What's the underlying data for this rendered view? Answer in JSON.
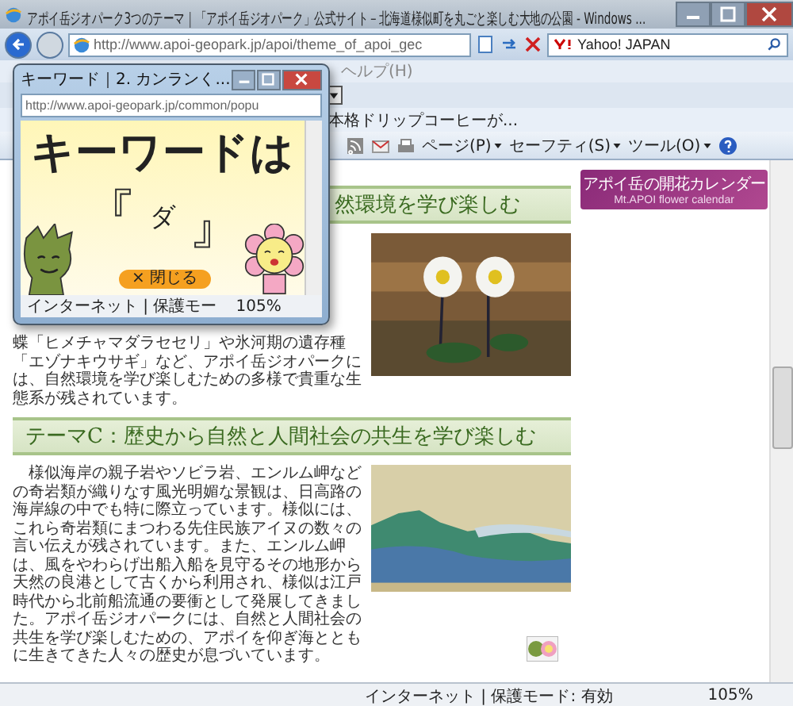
{
  "window": {
    "title": "アポイ岳ジオパーク3つのテーマ｜「アポイ岳ジオパーク」公式サイト－北海道様似町を丸ごと楽しむ大地の公園 - Windows ..."
  },
  "address_bar": {
    "url": "http://www.apoi-geopark.jp/apoi/theme_of_apoi_gec",
    "search_value": "Yahoo! JAPAN"
  },
  "menu": [
    "ヘルプ(H)"
  ],
  "favorites_link": "本格ドリップコーヒーが...",
  "command_bar": [
    "ページ(P)",
    "セーフティ(S)",
    "ツール(O)"
  ],
  "page": {
    "theme_b": {
      "heading": "然環境を学び楽しむ",
      "text": "蝶「ヒメチャマダラセセリ」や氷河期の遺存種「エゾナキウサギ」など、アポイ岳ジオパークには、自然環境を学び楽しむための多様で貴重な生態系が残されています。"
    },
    "banner": {
      "title": "アポイ岳の開花カレンダー",
      "subtitle": "Mt.APOI flower calendar"
    },
    "theme_c": {
      "heading": "テーマC：歴史から自然と人間社会の共生を学び楽しむ",
      "text": "　様似海岸の親子岩やソビラ岩、エンルム岬などの奇岩類が織りなす風光明媚な景観は、日高路の海岸線の中でも特に際立っています。様似には、これら奇岩類にまつわる先住民族アイヌの数々の言い伝えが残されています。また、エンルム岬は、風をやわらげ出船入船を見守るその地形から天然の良港として古くから利用され、様似は江戸時代から北前船流通の要衝として発展してきました。アポイ岳ジオパークには、自然と人間社会の共生を学び楽しむための、アポイを仰ぎ海とともに生きてきた人々の歴史が息づいています。"
    }
  },
  "status_bar": {
    "zone": "インターネット | 保護モード: 有効",
    "zoom": "105%"
  },
  "popup": {
    "title": "キーワード｜2. カンランく...",
    "url": "http://www.apoi-geopark.jp/common/popu",
    "heading": "キーワードは",
    "bracket_open": "『",
    "keyword": "ダ",
    "bracket_close": "』",
    "close_button": "× 閉じる",
    "status_zone": "インターネット | 保護モー",
    "zoom": "105%"
  }
}
